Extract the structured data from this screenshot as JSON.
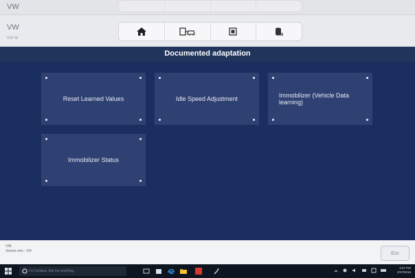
{
  "header": {
    "brand_top": "VW",
    "brand": "VW",
    "brand_sub": "VW M",
    "toolbar_icons": [
      "home-icon",
      "car-diagnostics-icon",
      "screen-capture-icon",
      "data-log-icon"
    ]
  },
  "page_title": "Documented adaptation",
  "tiles": [
    {
      "label": "Reset Learned Values"
    },
    {
      "label": "Idle Speed Adjustment"
    },
    {
      "label": "Immobilizer (Vehicle Data learning)"
    },
    {
      "label": "Immobilizer Status"
    }
  ],
  "footer": {
    "vin_label": "VIN:",
    "vehicle_info": "Vehicle info.: VW",
    "esc_label": "Esc"
  },
  "taskbar": {
    "search_placeholder": "I'm Cortana. Ask me anything.",
    "time": "3:57 PM",
    "date": "2/27/2016"
  },
  "colors": {
    "header_bg": "#e9eaee",
    "title_bar": "#20345c",
    "main_bg": "#1a2f60",
    "tile_bg": "#2f4173",
    "taskbar_bg": "#0d1520"
  }
}
